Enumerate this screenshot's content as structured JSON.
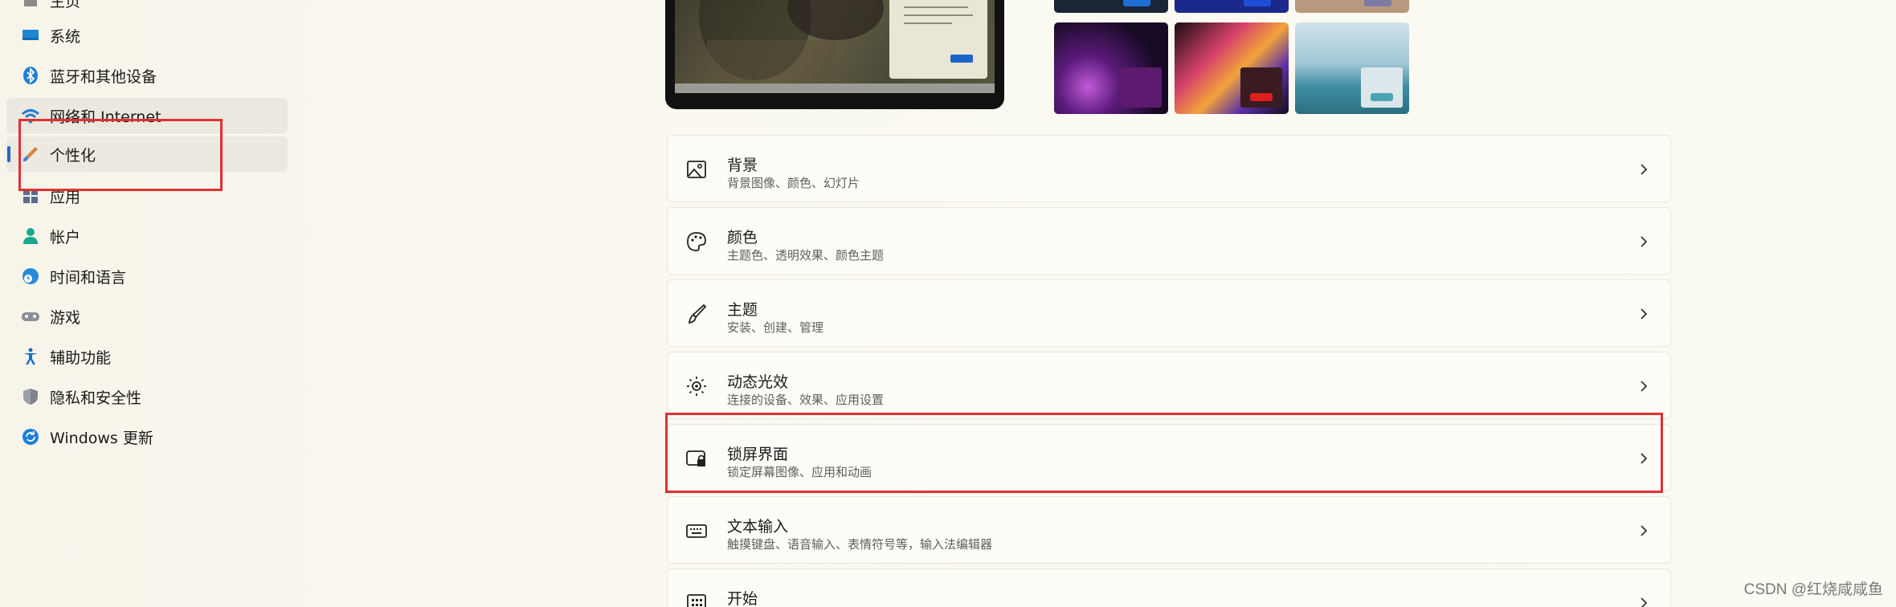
{
  "sidebar": {
    "items": [
      {
        "label": "主页",
        "icon": "home-icon"
      },
      {
        "label": "系统",
        "icon": "system-icon"
      },
      {
        "label": "蓝牙和其他设备",
        "icon": "bluetooth-icon"
      },
      {
        "label": "网络和 Internet",
        "icon": "wifi-icon"
      },
      {
        "label": "个性化",
        "icon": "brush-icon",
        "selected": true
      },
      {
        "label": "应用",
        "icon": "apps-icon"
      },
      {
        "label": "帐户",
        "icon": "account-icon"
      },
      {
        "label": "时间和语言",
        "icon": "globe-clock-icon"
      },
      {
        "label": "游戏",
        "icon": "gamepad-icon"
      },
      {
        "label": "辅助功能",
        "icon": "accessibility-icon"
      },
      {
        "label": "隐私和安全性",
        "icon": "shield-icon"
      },
      {
        "label": "Windows 更新",
        "icon": "update-icon"
      }
    ]
  },
  "cards": [
    {
      "title": "背景",
      "subtitle": "背景图像、颜色、幻灯片",
      "icon": "image-icon"
    },
    {
      "title": "颜色",
      "subtitle": "主题色、透明效果、颜色主题",
      "icon": "palette-icon"
    },
    {
      "title": "主题",
      "subtitle": "安装、创建、管理",
      "icon": "theme-brush-icon"
    },
    {
      "title": "动态光效",
      "subtitle": "连接的设备、效果、应用设置",
      "icon": "lighting-icon"
    },
    {
      "title": "锁屏界面",
      "subtitle": "锁定屏幕图像、应用和动画",
      "icon": "lock-screen-icon"
    },
    {
      "title": "文本输入",
      "subtitle": "触摸键盘、语音输入、表情符号等，输入法编辑器",
      "icon": "keyboard-icon"
    },
    {
      "title": "开始",
      "subtitle": "",
      "icon": "start-icon"
    }
  ],
  "colors": {
    "accent": "#2b63c6",
    "annotation": "#e03030"
  },
  "watermark": "CSDN @红烧咸咸鱼"
}
